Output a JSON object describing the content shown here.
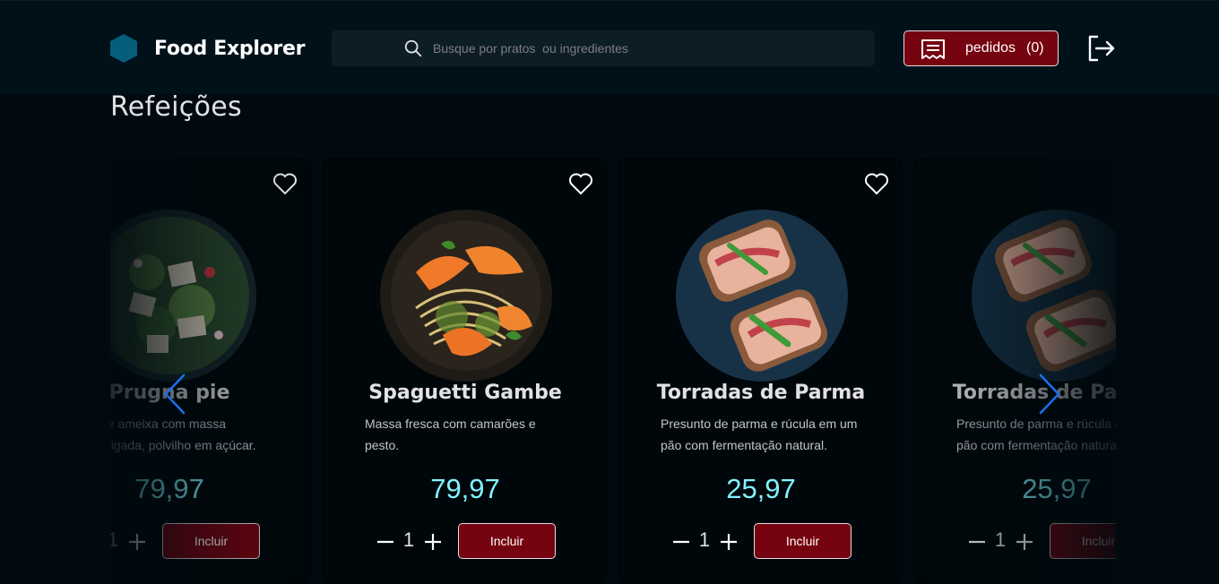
{
  "header": {
    "brand": "Food Explorer",
    "search_placeholder": "Busque por pratos  ou ingredientes",
    "orders_label": "pedidos",
    "orders_count": "(0)"
  },
  "section": {
    "title": "Refeições"
  },
  "cards": [
    {
      "name": "Prugna pie",
      "description": "Torta de ameixa com massa amanteigada, polvilho em açúcar.",
      "price": "79,97",
      "quantity": "1",
      "button": "Incluir",
      "image": "salad"
    },
    {
      "name": "Spaguetti Gambe",
      "description": "Massa fresca com camarões e pesto.",
      "price": "79,97",
      "quantity": "1",
      "button": "Incluir",
      "image": "shrimp-pasta"
    },
    {
      "name": "Torradas de Parma",
      "description": "Presunto de parma e rúcula em um pão com fermentação natural.",
      "price": "25,97",
      "quantity": "1",
      "button": "Incluir",
      "image": "parma-toast"
    },
    {
      "name": "Torradas de Parma",
      "description": "Presunto de parma e rúcula em um pão com fermentação natural.",
      "price": "25,97",
      "quantity": "1",
      "button": "Incluir",
      "image": "parma-toast"
    }
  ],
  "colors": {
    "background": "#000a0f",
    "header": "#00111a",
    "accent_red": "#750310",
    "price_cyan": "#82f3ff",
    "arrow_blue": "#1a6fe8"
  }
}
